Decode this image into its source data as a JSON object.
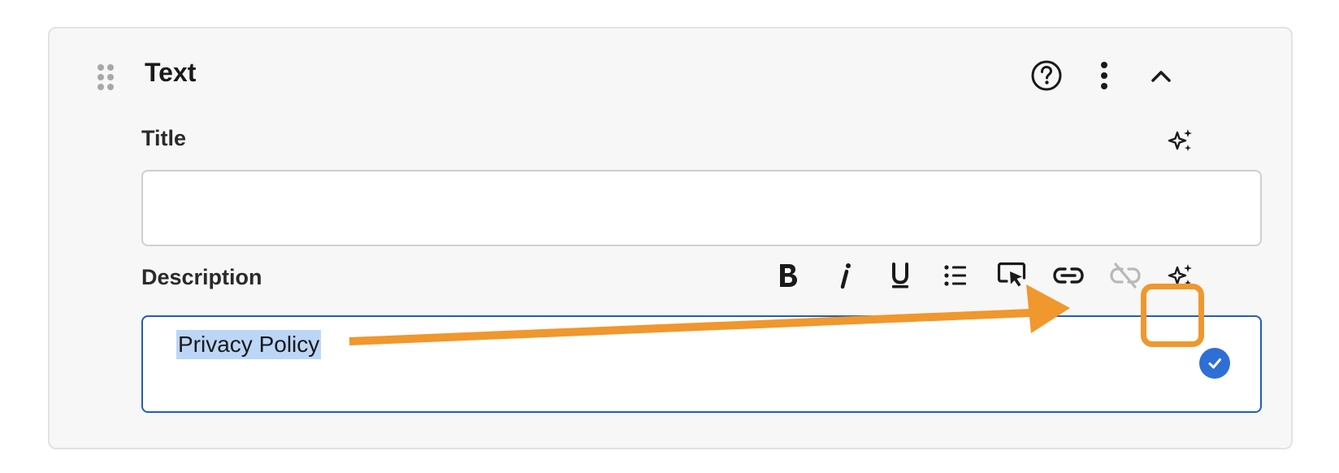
{
  "block": {
    "title": "Text",
    "icons": [
      "drag-handle-icon",
      "help-icon",
      "more-vertical-icon",
      "chevron-up-icon"
    ]
  },
  "title_field": {
    "label": "Title",
    "value": "",
    "ai_icon": "sparkle-icon"
  },
  "description_field": {
    "label": "Description",
    "selected_text": "Privacy Policy",
    "toolbar": [
      "bold-icon",
      "italic-icon",
      "underline-icon",
      "bullet-list-icon",
      "cursor-select-icon",
      "link-icon",
      "unlink-icon",
      "sparkle-icon"
    ],
    "status_icon": "check-circle-icon"
  },
  "annotation": {
    "highlight_color": "#f0972d",
    "target": "link-icon"
  },
  "colors": {
    "card_bg": "#f7f7f7",
    "focus_border": "#1f5fb8",
    "selection": "#bcd6f7",
    "check_badge": "#2e6fd6"
  }
}
